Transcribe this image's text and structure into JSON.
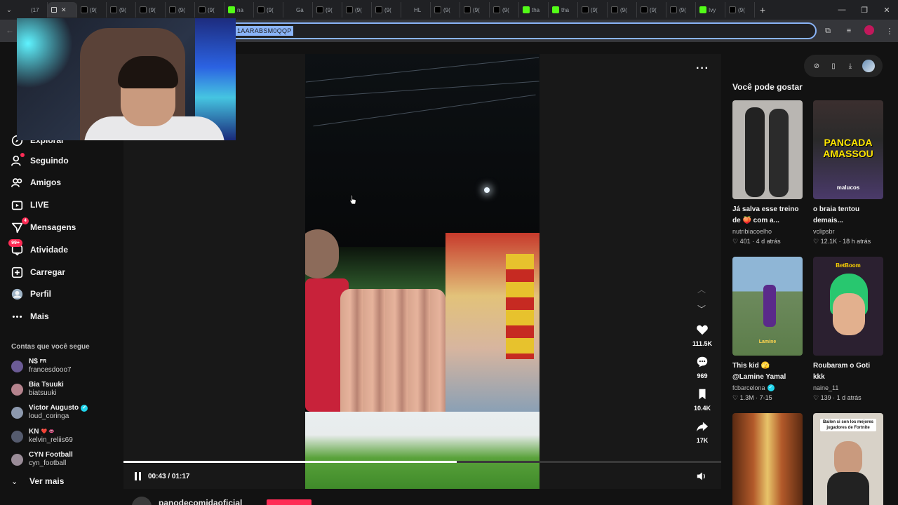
{
  "browser": {
    "tabs": [
      {
        "label": "(17",
        "icon": "youtube"
      },
      {
        "label": "",
        "icon": "speaker",
        "close": "✕",
        "active": true
      },
      {
        "label": "(9(",
        "icon": "tiktok"
      },
      {
        "label": "(9(",
        "icon": "tiktok"
      },
      {
        "label": "(9(",
        "icon": "tiktok"
      },
      {
        "label": "(9(",
        "icon": "tiktok"
      },
      {
        "label": "(9(",
        "icon": "tiktok"
      },
      {
        "label": "na",
        "icon": "kick"
      },
      {
        "label": "(9(",
        "icon": "tiktok"
      },
      {
        "label": "Ga",
        "icon": "youtube"
      },
      {
        "label": "(9(",
        "icon": "tiktok"
      },
      {
        "label": "(9(",
        "icon": "tiktok"
      },
      {
        "label": "(9(",
        "icon": "tiktok"
      },
      {
        "label": "HL",
        "icon": "youtube"
      },
      {
        "label": "(9(",
        "icon": "tiktok"
      },
      {
        "label": "(9(",
        "icon": "tiktok"
      },
      {
        "label": "(9(",
        "icon": "tiktok"
      },
      {
        "label": "tha",
        "icon": "kick"
      },
      {
        "label": "tha",
        "icon": "kick"
      },
      {
        "label": "(9(",
        "icon": "tiktok"
      },
      {
        "label": "(9(",
        "icon": "tiktok"
      },
      {
        "label": "(9(",
        "icon": "tiktok"
      },
      {
        "label": "(9(",
        "icon": "tiktok"
      },
      {
        "label": "Ivy",
        "icon": "kick"
      },
      {
        "label": "(9(",
        "icon": "tiktok"
      }
    ],
    "url_selected": "1AARABSM0QQP"
  },
  "sidebar": {
    "nav": [
      {
        "label": "Explorar",
        "icon": "compass-icon"
      },
      {
        "label": "Seguindo",
        "icon": "following-icon"
      },
      {
        "label": "Amigos",
        "icon": "friends-icon"
      },
      {
        "label": "LIVE",
        "icon": "live-icon"
      },
      {
        "label": "Mensagens",
        "icon": "messages-icon",
        "badge": "4"
      },
      {
        "label": "Atividade",
        "icon": "activity-icon",
        "badge": "99+"
      },
      {
        "label": "Carregar",
        "icon": "upload-icon"
      },
      {
        "label": "Perfil",
        "icon": "profile-icon"
      },
      {
        "label": "Mais",
        "icon": "more-icon"
      }
    ],
    "following_title": "Contas que você segue",
    "following": [
      {
        "name": "N$",
        "name_suffix": "FR",
        "user": "francesdooo7",
        "color": "#6b5b95"
      },
      {
        "name": "Bia Tsuuki",
        "user": "biatsuuki",
        "color": "#b5838d"
      },
      {
        "name": "Victor Augusto",
        "user": "loud_coringa",
        "color": "#8d99ae",
        "verified": true
      },
      {
        "name": "KN",
        "name_suffix": "❤️ 👄",
        "user": "kelvin_reliis69",
        "color": "#555b6e"
      },
      {
        "name": "CYN Football",
        "user": "cyn_football",
        "color": "#9a8c98"
      }
    ],
    "see_more": "Ver mais"
  },
  "player": {
    "likes": "111.5K",
    "comments": "969",
    "saves": "10.4K",
    "shares": "17K",
    "time": "00:43 / 01:17",
    "progress_fraction": 0.558,
    "author": "panodecomidaoficial"
  },
  "right": {
    "title": "Você pode gostar",
    "cards": [
      {
        "caption": "Já salva esse treino de 🍑 com a...",
        "user": "nutribiacoelho",
        "likes": "401",
        "age": "4 d atrás",
        "bg": "#b9b6b2",
        "thumb_text": ""
      },
      {
        "caption": "o braia tentou demais...",
        "user": "vclipsbr",
        "likes": "12.1K",
        "age": "18 h atrás",
        "bg": "#3b2f2f",
        "thumb_text": "PANCADA AMASSOU",
        "thumb_sub": "malucos"
      },
      {
        "caption": "This kid 🫣 @Lamine Yamal #fcbarcelon...",
        "user": "fcbarcelona",
        "likes": "1.3M",
        "age": "7-15",
        "bg": "#6d8a5d",
        "verified": true,
        "thumb_text": "",
        "thumb_sub": "Lamine"
      },
      {
        "caption": "Roubaram o Goti kkk",
        "user": "naine_11",
        "likes": "139",
        "age": "1 d atrás",
        "bg": "#2b2030",
        "thumb_text": "BetBoom"
      },
      {
        "caption": "",
        "user": "",
        "likes": "",
        "age": "",
        "bg": "#b35a2a",
        "thumb_text": ""
      },
      {
        "caption": "",
        "user": "",
        "likes": "",
        "age": "",
        "bg": "#d8d2c8",
        "thumb_text": "Bailen si son los mejores jugadores de Fortnite"
      }
    ]
  }
}
